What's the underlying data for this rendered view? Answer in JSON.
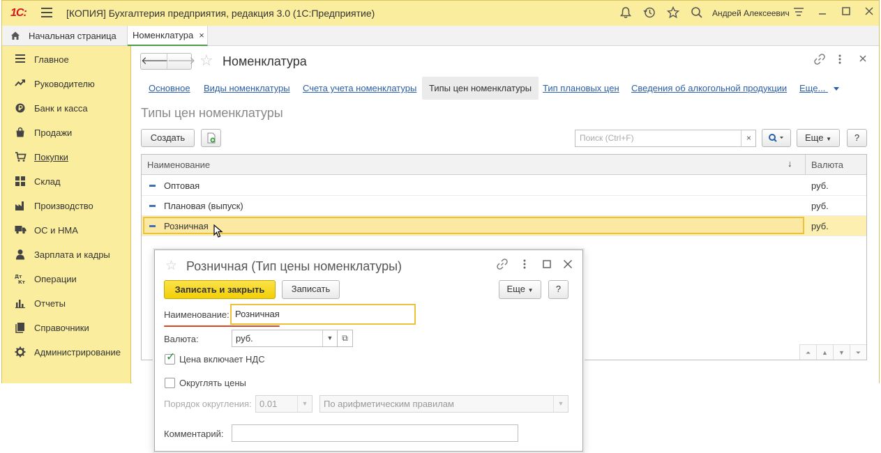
{
  "app": {
    "logo": "1С:",
    "title": "[КОПИЯ] Бухгалтерия предприятия, редакция 3.0  (1С:Предприятие)",
    "user": "Андрей Алексеевич"
  },
  "tabs": {
    "home": "Начальная страница",
    "doc": "Номенклатура",
    "close": "×"
  },
  "sidebar": {
    "items": [
      {
        "label": "Главное",
        "icon": "menu-icon"
      },
      {
        "label": "Руководителю",
        "icon": "trend-icon"
      },
      {
        "label": "Банк и касса",
        "icon": "coin-icon"
      },
      {
        "label": "Продажи",
        "icon": "bag-icon"
      },
      {
        "label": "Покупки",
        "icon": "cart-icon"
      },
      {
        "label": "Склад",
        "icon": "warehouse-icon"
      },
      {
        "label": "Производство",
        "icon": "factory-icon"
      },
      {
        "label": "ОС и НМА",
        "icon": "truck-icon"
      },
      {
        "label": "Зарплата и кадры",
        "icon": "person-icon"
      },
      {
        "label": "Операции",
        "icon": "dt-kt-icon"
      },
      {
        "label": "Отчеты",
        "icon": "bar-chart-icon"
      },
      {
        "label": "Справочники",
        "icon": "book-icon"
      },
      {
        "label": "Администрирование",
        "icon": "gear-icon"
      }
    ],
    "active_index": 4
  },
  "form": {
    "title": "Номенклатура",
    "sections": [
      "Основное",
      "Виды номенклатуры",
      "Счета учета номенклатуры",
      "Типы цен номенклатуры",
      "Тип плановых цен",
      "Сведения об алкогольной продукции",
      "Еще..."
    ],
    "active_section": 3,
    "list_title": "Типы цен номенклатуры",
    "create_label": "Создать",
    "search_placeholder": "Поиск (Ctrl+F)",
    "search_clear": "×",
    "more_label": "Еще",
    "help_label": "?"
  },
  "table": {
    "columns": [
      "Наименование",
      "Валюта"
    ],
    "sort_indicator": "↓",
    "rows": [
      {
        "name": "Оптовая",
        "currency": "руб."
      },
      {
        "name": "Плановая (выпуск)",
        "currency": "руб."
      },
      {
        "name": "Розничная",
        "currency": "руб."
      }
    ],
    "selected_index": 2
  },
  "dialog": {
    "title": "Розничная (Тип цены номенклатуры)",
    "save_close_label": "Записать и закрыть",
    "save_label": "Записать",
    "more_label": "Еще",
    "help_label": "?",
    "name_label": "Наименование:",
    "name_value": "Розничная",
    "currency_label": "Валюта:",
    "currency_value": "руб.",
    "vat_label": "Цена включает НДС",
    "vat_checked": true,
    "round_label": "Округлять цены",
    "round_checked": false,
    "rounding_order_label": "Порядок округления:",
    "rounding_order_value": "0.01",
    "rounding_rule_value": "По арифметическим правилам",
    "comment_label": "Комментарий:",
    "comment_value": ""
  }
}
